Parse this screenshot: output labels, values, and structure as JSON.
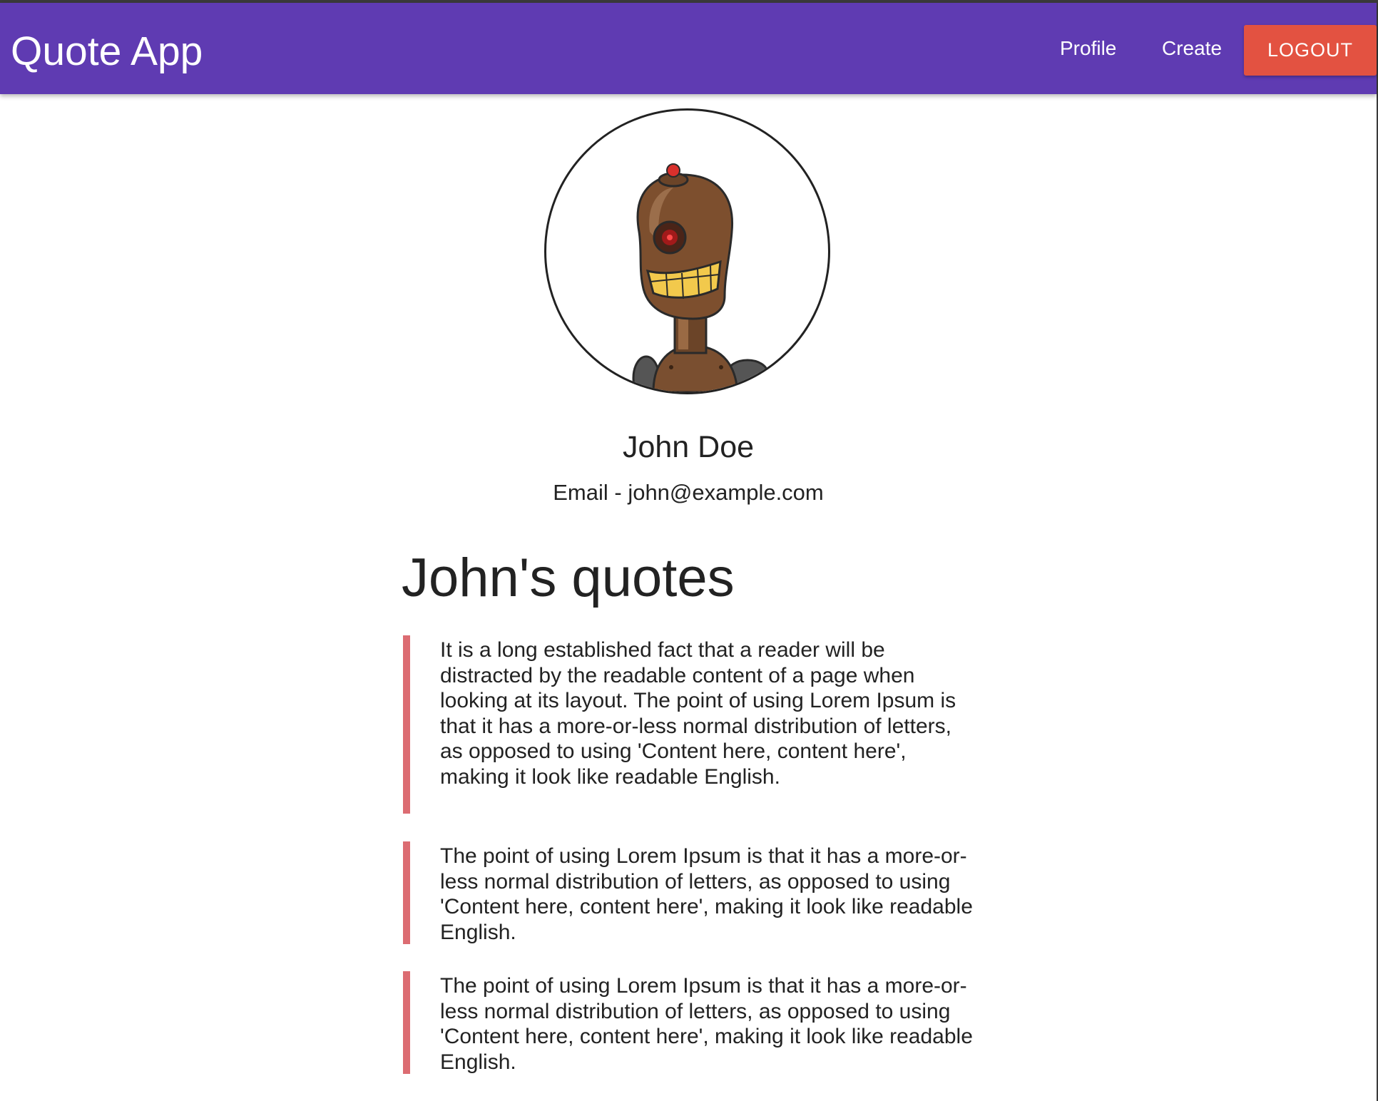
{
  "app": {
    "brand": "Quote App"
  },
  "nav": {
    "profile_label": "Profile",
    "create_label": "Create",
    "logout_label": "LOGOUT"
  },
  "colors": {
    "navbar": "#5f3bb2",
    "logout_button": "#e35241",
    "quote_border": "#dc6c72"
  },
  "profile": {
    "avatar_icon": "robot-avatar-icon",
    "name": "John Doe",
    "email_label": "Email - john@example.com"
  },
  "quotes_section": {
    "heading": "John's quotes",
    "quotes": [
      {
        "text": "It is a long established fact that a reader will be distracted by the readable content of a page when looking at its layout. The point of using Lorem Ipsum is that it has a more-or-less normal distribution of letters, as opposed to using 'Content here, content here', making it look like readable English."
      },
      {
        "text": "The point of using Lorem Ipsum is that it has a more-or-less normal distribution of letters, as opposed to using 'Content here, content here', making it look like readable English."
      },
      {
        "text": "The point of using Lorem Ipsum is that it has a more-or-less normal distribution of letters, as opposed to using 'Content here, content here', making it look like readable English."
      }
    ]
  }
}
